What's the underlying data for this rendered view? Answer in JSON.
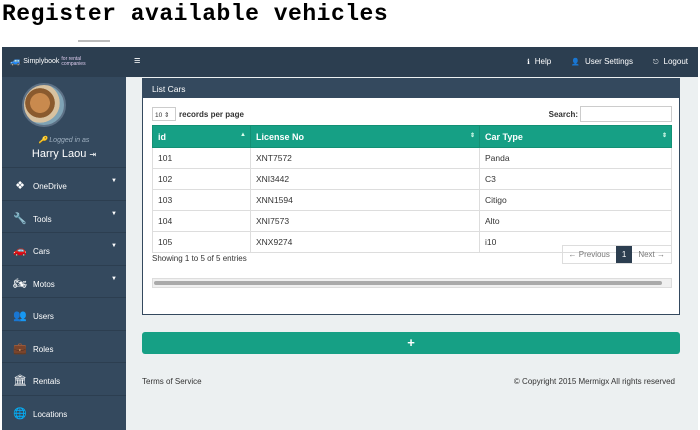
{
  "caption": "Register available vehicles",
  "topbar": {
    "logo_text": "Simplybook",
    "logo_sub": "for rental companies",
    "help_label": "Help",
    "settings_label": "User Settings",
    "logout_label": "Logout"
  },
  "profile": {
    "logged_in_text": "Logged in as",
    "user_name": "Harry Laou"
  },
  "sidebar": {
    "items": [
      {
        "label": "OneDrive",
        "icon": "dropbox-icon",
        "glyph": "❖",
        "has_caret": true
      },
      {
        "label": "Tools",
        "icon": "wrench-icon",
        "glyph": "🔧",
        "has_caret": true
      },
      {
        "label": "Cars",
        "icon": "car-icon",
        "glyph": "🚗",
        "has_caret": true
      },
      {
        "label": "Motos",
        "icon": "motorcycle-icon",
        "glyph": "🏍",
        "has_caret": true
      },
      {
        "label": "Users",
        "icon": "users-icon",
        "glyph": "👥",
        "has_caret": false
      },
      {
        "label": "Roles",
        "icon": "briefcase-icon",
        "glyph": "💼",
        "has_caret": false
      },
      {
        "label": "Rentals",
        "icon": "bank-icon",
        "glyph": "🏛",
        "has_caret": false
      },
      {
        "label": "Locations",
        "icon": "globe-icon",
        "glyph": "🌐",
        "has_caret": false
      }
    ]
  },
  "panel": {
    "title": "List Cars",
    "length_value": "10",
    "length_label": "records per page",
    "search_label": "Search:",
    "search_value": "",
    "columns": [
      "id",
      "License No",
      "Car Type"
    ],
    "rows": [
      [
        "101",
        "XNT7572",
        "Panda"
      ],
      [
        "102",
        "XNI3442",
        "C3"
      ],
      [
        "103",
        "XNN1594",
        "Citigo"
      ],
      [
        "104",
        "XNI7573",
        "Alto"
      ],
      [
        "105",
        "XNX9274",
        "i10"
      ]
    ],
    "info": "Showing 1 to 5 of 5 entries",
    "pager": {
      "prev": "← Previous",
      "current": "1",
      "next": "Next →"
    }
  },
  "add_button_label": "+",
  "footer": {
    "terms": "Terms of Service",
    "copyright": "© Copyright 2015 Mermigx All rights reserved"
  },
  "colors": {
    "navy": "#2c3e50",
    "sidebar": "#34495e",
    "accent": "#16a085",
    "background": "#ecf0f1"
  }
}
